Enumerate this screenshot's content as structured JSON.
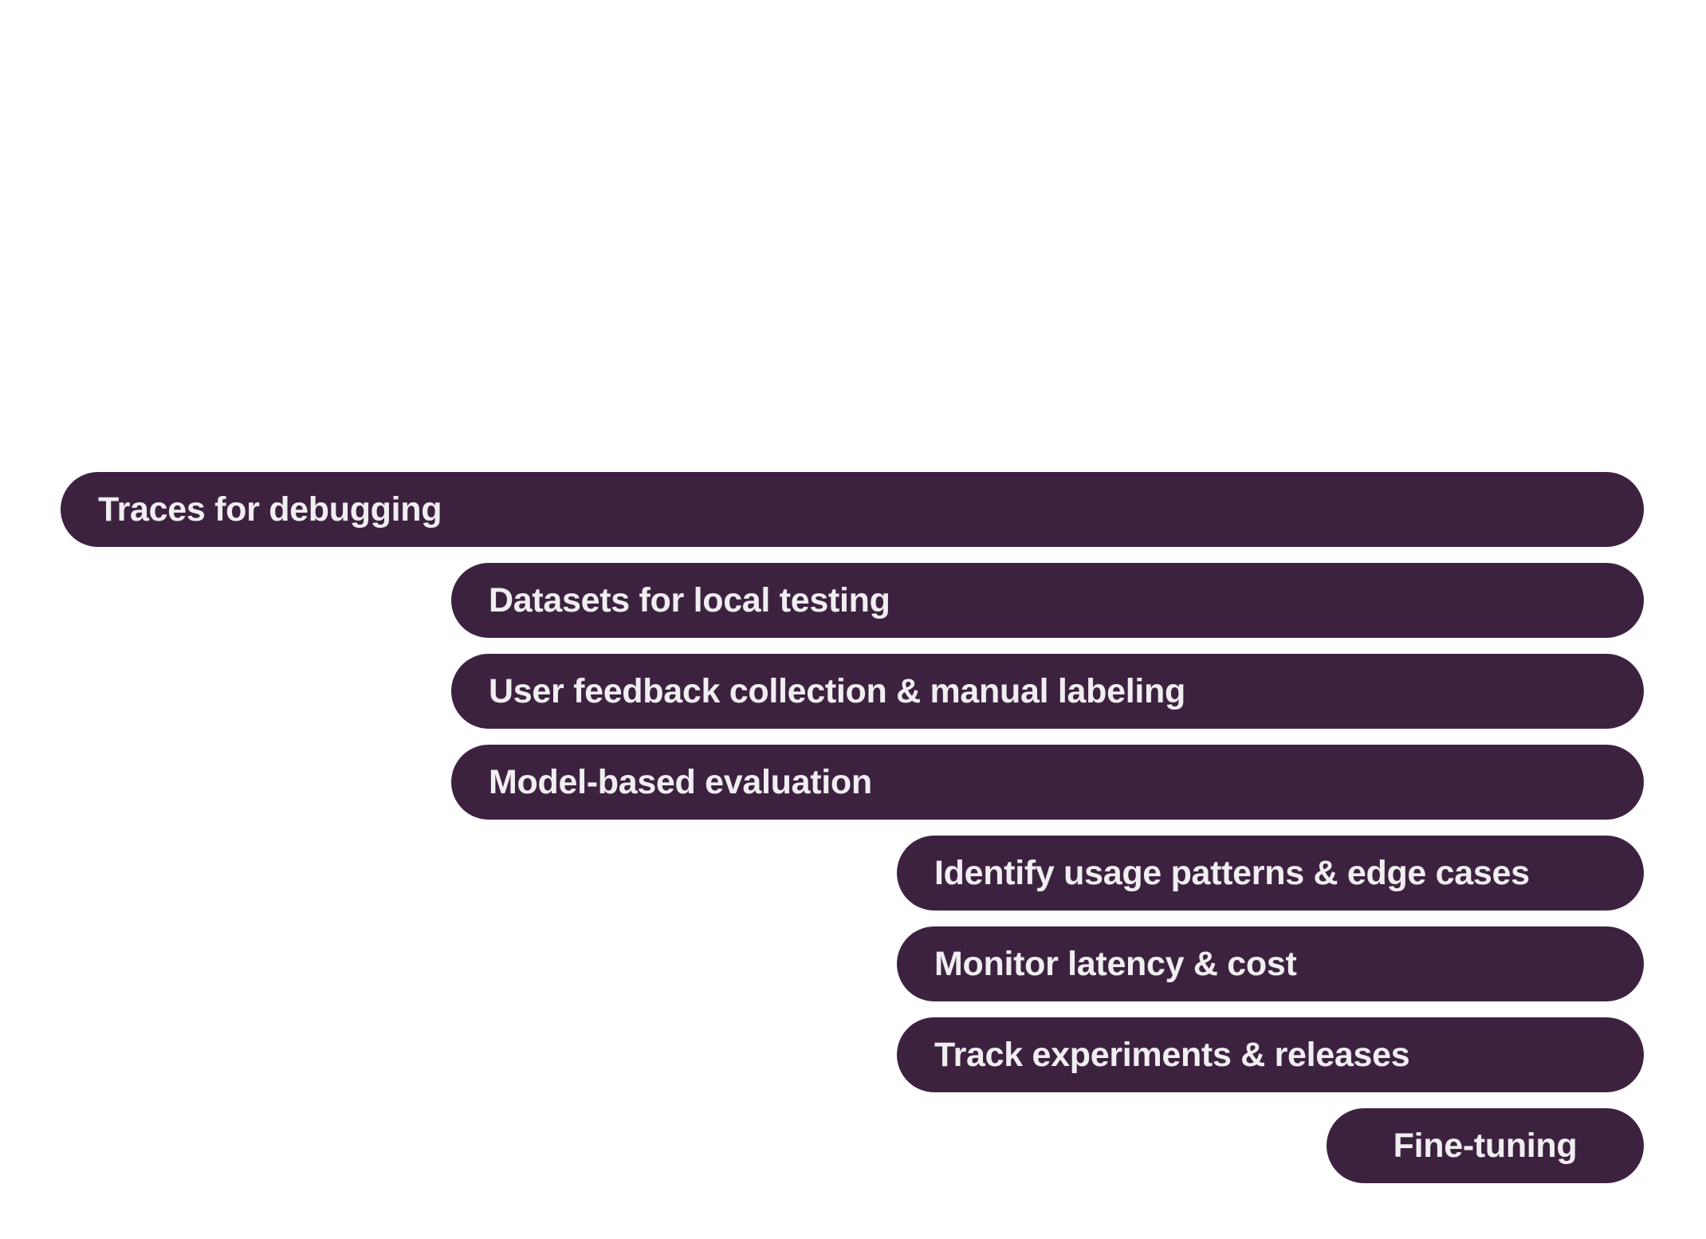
{
  "diagram": {
    "fill_color": "#3d2240",
    "text_color": "#f0eef0",
    "items": [
      {
        "label": "Traces for debugging",
        "stage": 0
      },
      {
        "label": "Datasets for local testing",
        "stage": 1
      },
      {
        "label": "User feedback collection & manual labeling",
        "stage": 1
      },
      {
        "label": "Model-based evaluation",
        "stage": 1
      },
      {
        "label": "Identify usage patterns & edge cases",
        "stage": 2
      },
      {
        "label": "Monitor latency & cost",
        "stage": 2
      },
      {
        "label": "Track experiments & releases",
        "stage": 2
      },
      {
        "label": "Fine-tuning",
        "stage": 3
      }
    ]
  }
}
